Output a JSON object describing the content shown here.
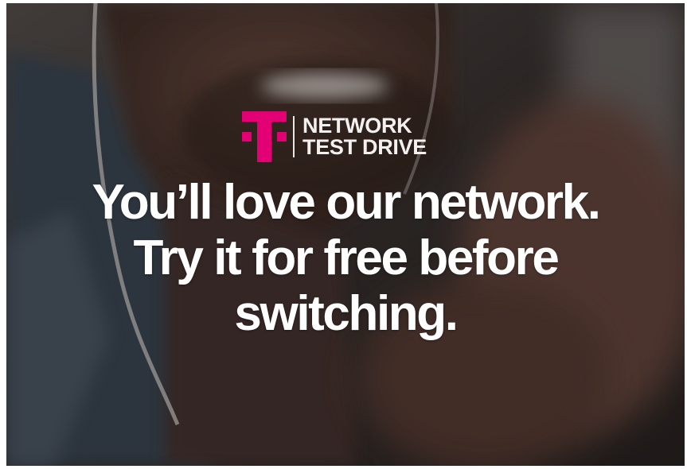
{
  "banner": {
    "logo": {
      "icon": "t-mobile-logo-icon",
      "line1": "NETWORK",
      "line2": "TEST DRIVE",
      "brand_color": "#e20074"
    },
    "headline": {
      "line1": "You’ll love our network.",
      "line2": "Try it for free before",
      "line3": "switching."
    },
    "background_image": "man-smiling-with-earphones-photo"
  }
}
